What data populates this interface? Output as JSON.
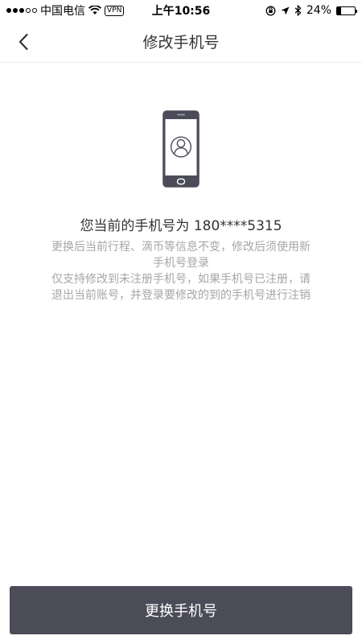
{
  "status_bar": {
    "carrier": "中国电信",
    "vpn": "VPN",
    "time": "上午10:56",
    "battery": "24%",
    "battery_level": 0.24,
    "icons": [
      "signal-dots-icon",
      "wifi-icon",
      "vpn-badge",
      "orientation-lock-icon",
      "location-icon",
      "bluetooth-icon",
      "battery-icon"
    ]
  },
  "nav": {
    "title": "修改手机号",
    "back_icon": "chevron-left-icon"
  },
  "content": {
    "illustration_icon": "phone-user-icon",
    "current_label": "您当前的手机号为 180****5315",
    "tip1_line1": "更换后当前行程、滴币等信息不变，修改后须使用新",
    "tip1_line2": "手机号登录",
    "tip2_line1": "仅支持修改到未注册手机号，如果手机号已注册，请",
    "tip2_line2": "退出当前账号，并登录要修改的到的手机号进行注销"
  },
  "footer": {
    "button_label": "更换手机号"
  },
  "colors": {
    "button_bg": "#4b4c58",
    "tip_text": "#a6a6a6",
    "title_text": "#333333"
  }
}
